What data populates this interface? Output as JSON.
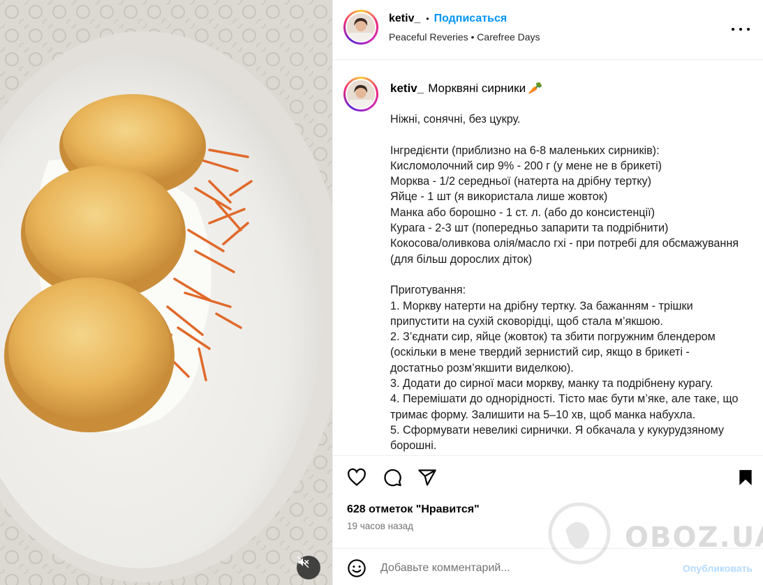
{
  "post": {
    "username": "ketiv_",
    "follow_label": "Подписаться",
    "subtitle": "Peaceful Reveries • Carefree Days",
    "caption_title": "Морквяні сирники",
    "caption_emoji": "🥕",
    "caption_lines": [
      "Ніжні, сонячні, без цукру.",
      "",
      "Інгредієнти (приблизно на 6-8 маленьких сирників):",
      "Кисломолочний сир 9% - 200 г (у мене не в брикеті)",
      "Морква - 1/2 середньої (натерта на дрібну тертку)",
      "Яйце - 1 шт (я використала лише жовток)",
      "Манка або борошно - 1 ст. л. (або до консистенції)",
      "Курага - 2-3 шт (попередньо запарити та подрібнити)",
      "Кокосова/оливкова олія/масло гхі - при потребі для обсмажування (для більш дорослих діток)",
      "",
      "Приготування:",
      "1. Моркву натерти на дрібну тертку. За бажанням - трішки припустити на сухій сковорідці, щоб стала м’якшою.",
      "2. З’єднати сир, яйце (жовток) та збити погружним блендером (оскільки в мене твердий зернистий сир, якщо в брикеті - достатньо розм’якшити виделкою).",
      "3. Додати до сирної маси моркву, манку та подрібнену курагу.",
      "4. Перемішати до однорідності. Тісто має бути м’яке, але таке, що тримає форму. Залишити на 5–10 хв, щоб манка набухла.",
      "5. Сформувати невеликі сирнички. Я обкачала у кукурудзяному борошні."
    ],
    "likes": "628 отметок \"Нравится\"",
    "time": "19 часов назад",
    "comment_placeholder": "Добавьте комментарий...",
    "publish_label": "Опубликовать"
  },
  "icons": {
    "more": "more-options-icon",
    "like": "heart-icon",
    "comment": "comment-icon",
    "share": "share-icon",
    "save": "bookmark-icon",
    "emoji": "emoji-icon",
    "mute": "muted-speaker-icon"
  },
  "watermark": {
    "text": "OBOZ.UA"
  },
  "colors": {
    "accent": "#0095f6",
    "publish_disabled": "#b3dbff",
    "muted_text": "#737373"
  }
}
